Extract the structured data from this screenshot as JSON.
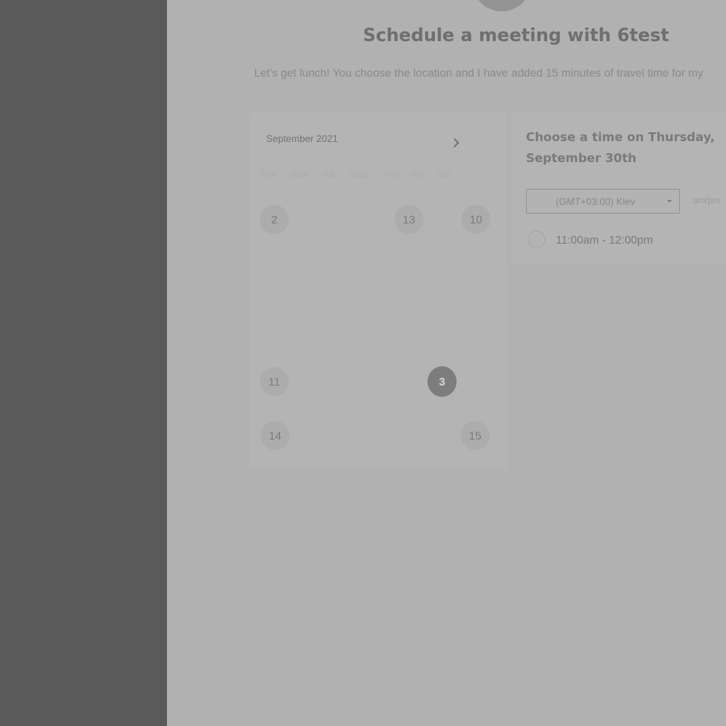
{
  "header": {
    "title": "Schedule a meeting with 6test",
    "description": "Let's get lunch! You choose the location and I have added 15 minutes of travel time for my"
  },
  "calendar": {
    "month_label": "September 2021",
    "weekdays": [
      "SUN",
      "MON",
      "TUE",
      "WED",
      "THU",
      "FRI",
      "SAT"
    ],
    "days": [
      {
        "label": "2"
      },
      {
        "label": "13"
      },
      {
        "label": "10"
      },
      {
        "label": "11"
      },
      {
        "label": "3",
        "selected": true
      },
      {
        "label": "14"
      },
      {
        "label": "15"
      }
    ]
  },
  "time_picker": {
    "heading": "Choose a time on Thursday, September 30th",
    "timezone": "(GMT+03:00) Kiev",
    "format_toggle": "am/pm",
    "slots": [
      {
        "label": "11:00am - 12:00pm"
      }
    ]
  },
  "colors": {
    "overlay_left": "#5a5a5a",
    "page_background": "#b1b1b1",
    "selected_day": "#7d7d7d"
  }
}
